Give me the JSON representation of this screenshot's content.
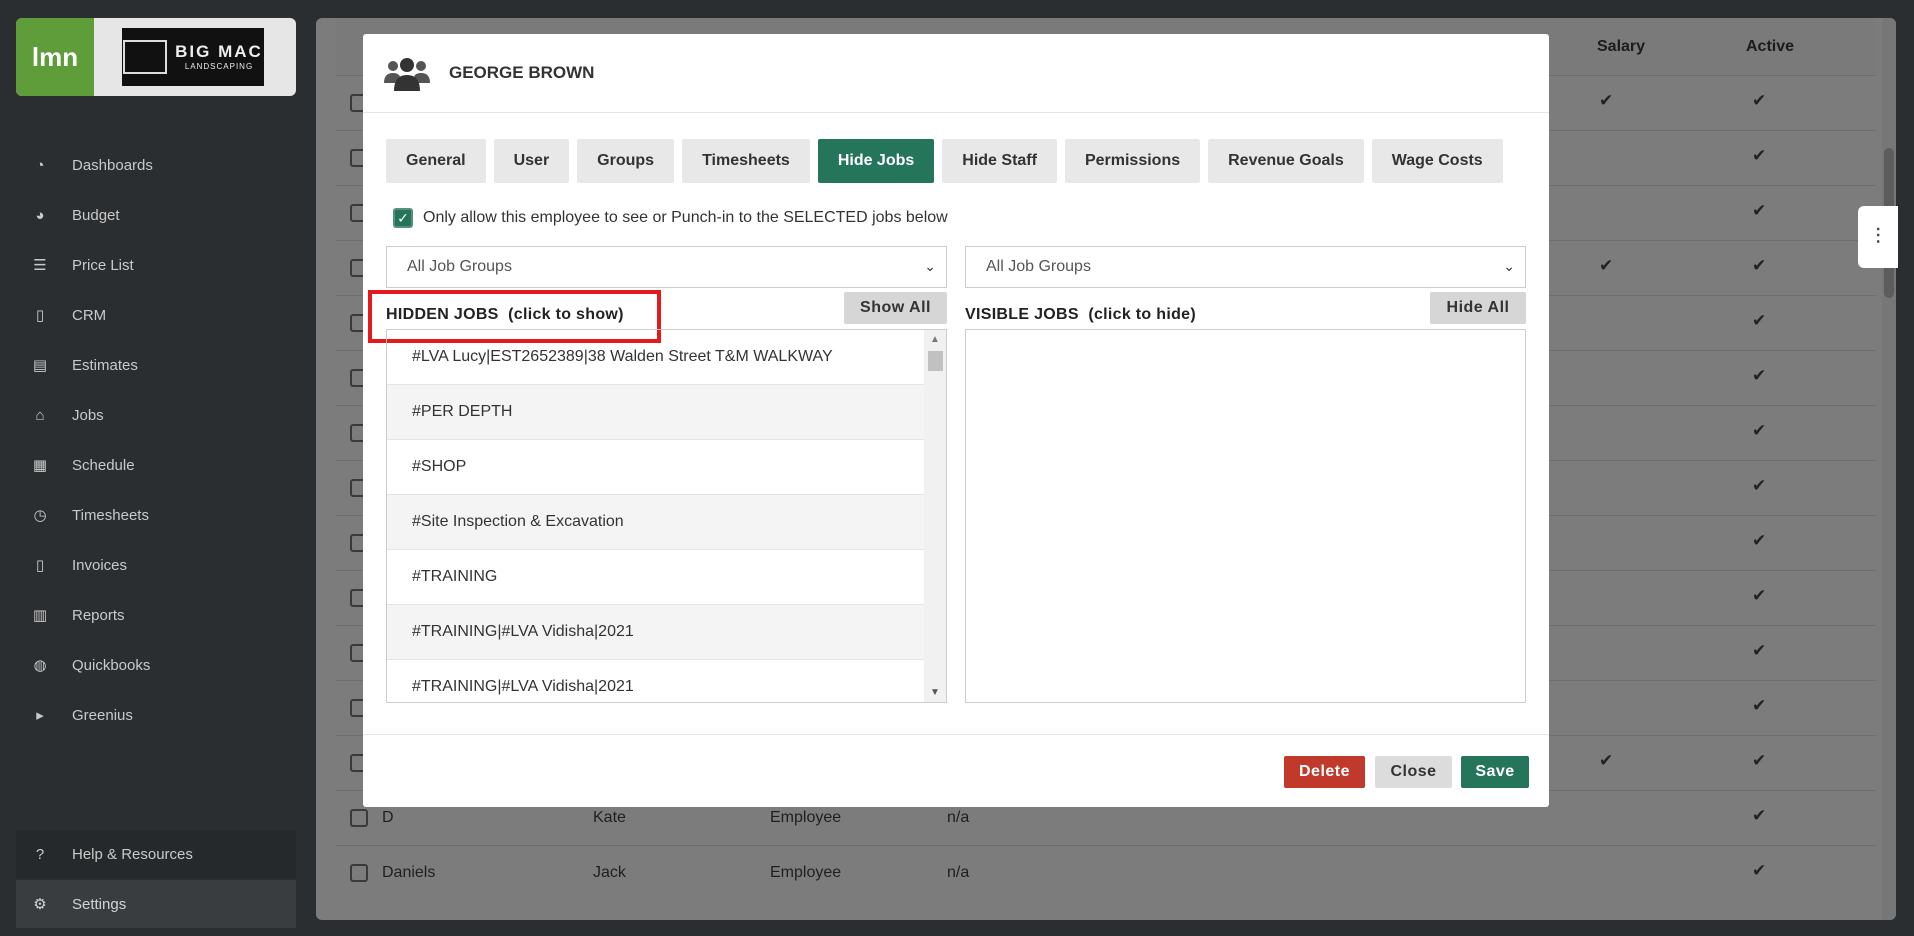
{
  "sidebar": {
    "brand_short": "lmn",
    "company_logo": "BIG MAC LANDSCAPING",
    "company_big": "BIG MAC",
    "company_small": "LANDSCAPING",
    "items": [
      {
        "label": "Dashboards",
        "icon": "dashboard-icon"
      },
      {
        "label": "Budget",
        "icon": "pie-chart-icon"
      },
      {
        "label": "Price List",
        "icon": "list-icon"
      },
      {
        "label": "CRM",
        "icon": "contact-icon"
      },
      {
        "label": "Estimates",
        "icon": "calculator-icon"
      },
      {
        "label": "Jobs",
        "icon": "building-icon"
      },
      {
        "label": "Schedule",
        "icon": "calendar-icon"
      },
      {
        "label": "Timesheets",
        "icon": "clock-icon"
      },
      {
        "label": "Invoices",
        "icon": "invoice-icon"
      },
      {
        "label": "Reports",
        "icon": "report-icon"
      },
      {
        "label": "Quickbooks",
        "icon": "quickbooks-icon"
      },
      {
        "label": "Greenius",
        "icon": "play-icon"
      }
    ],
    "help_label": "Help & Resources",
    "settings_label": "Settings"
  },
  "background_table": {
    "headers": {
      "salary": "Salary",
      "active": "Active"
    },
    "rows": [
      {
        "last": "D",
        "first": "Kate",
        "role": "Employee",
        "extra": "n/a"
      },
      {
        "last": "Daniels",
        "first": "Jack",
        "role": "Employee",
        "extra": "n/a"
      }
    ]
  },
  "modal": {
    "title": "GEORGE BROWN",
    "tabs": [
      {
        "label": "General",
        "active": false
      },
      {
        "label": "User",
        "active": false
      },
      {
        "label": "Groups",
        "active": false
      },
      {
        "label": "Timesheets",
        "active": false
      },
      {
        "label": "Hide Jobs",
        "active": true
      },
      {
        "label": "Hide Staff",
        "active": false
      },
      {
        "label": "Permissions",
        "active": false
      },
      {
        "label": "Revenue Goals",
        "active": false
      },
      {
        "label": "Wage Costs",
        "active": false
      }
    ],
    "only_allow_label": "Only allow this employee to see or Punch-in to the SELECTED jobs below",
    "only_allow_checked": true,
    "left_select_value": "All Job Groups",
    "right_select_value": "All Job Groups",
    "hidden_title": "HIDDEN JOBS  (click to show)",
    "visible_title": "VISIBLE JOBS  (click to hide)",
    "show_all_label": "Show All",
    "hide_all_label": "Hide All",
    "hidden_jobs": [
      "#LVA Lucy|EST2652389|38 Walden Street T&M WALKWAY",
      "#PER DEPTH",
      "#SHOP",
      "#Site Inspection & Excavation",
      "#TRAINING",
      "#TRAINING|#LVA Vidisha|2021",
      "#TRAINING|#LVA Vidisha|2021"
    ],
    "delete_label": "Delete",
    "close_label": "Close",
    "save_label": "Save"
  },
  "colors": {
    "accent": "#25755a",
    "delete": "#c0392b",
    "highlight": "#e3191b"
  }
}
